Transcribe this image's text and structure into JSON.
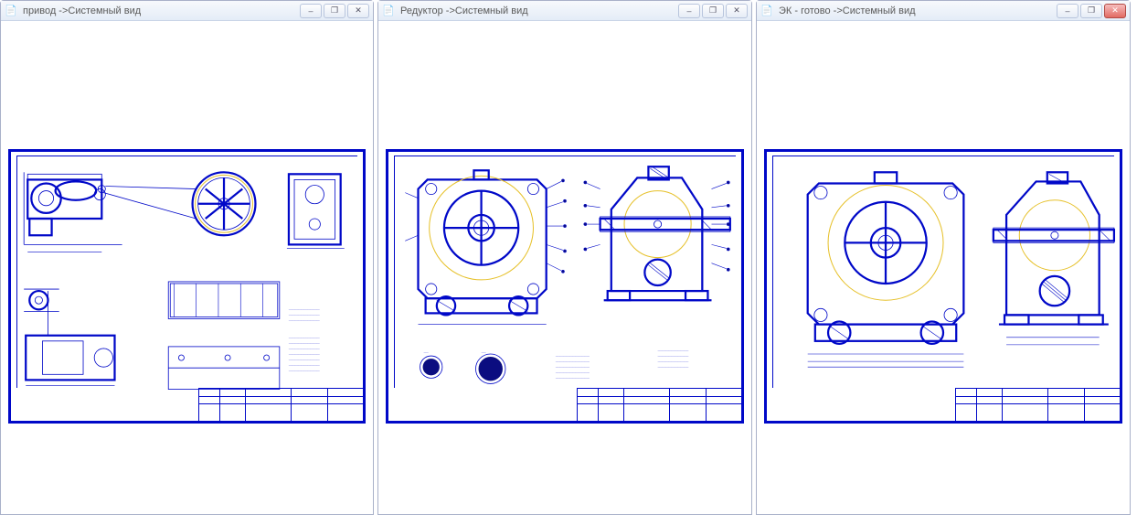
{
  "windows": [
    {
      "title": "привод ->Системный вид",
      "active": false
    },
    {
      "title": "Редуктор ->Системный вид",
      "active": false
    },
    {
      "title": "ЭК - готово ->Системный вид",
      "active": true
    }
  ],
  "winbuttons": {
    "minimize_glyph": "–",
    "restore_glyph": "❐",
    "close_glyph": "✕"
  },
  "icons": {
    "doc_icon": "📄"
  },
  "colors": {
    "cad_blue": "#0008c8",
    "cad_gold": "#e6c028",
    "close_red": "#e26a62"
  }
}
